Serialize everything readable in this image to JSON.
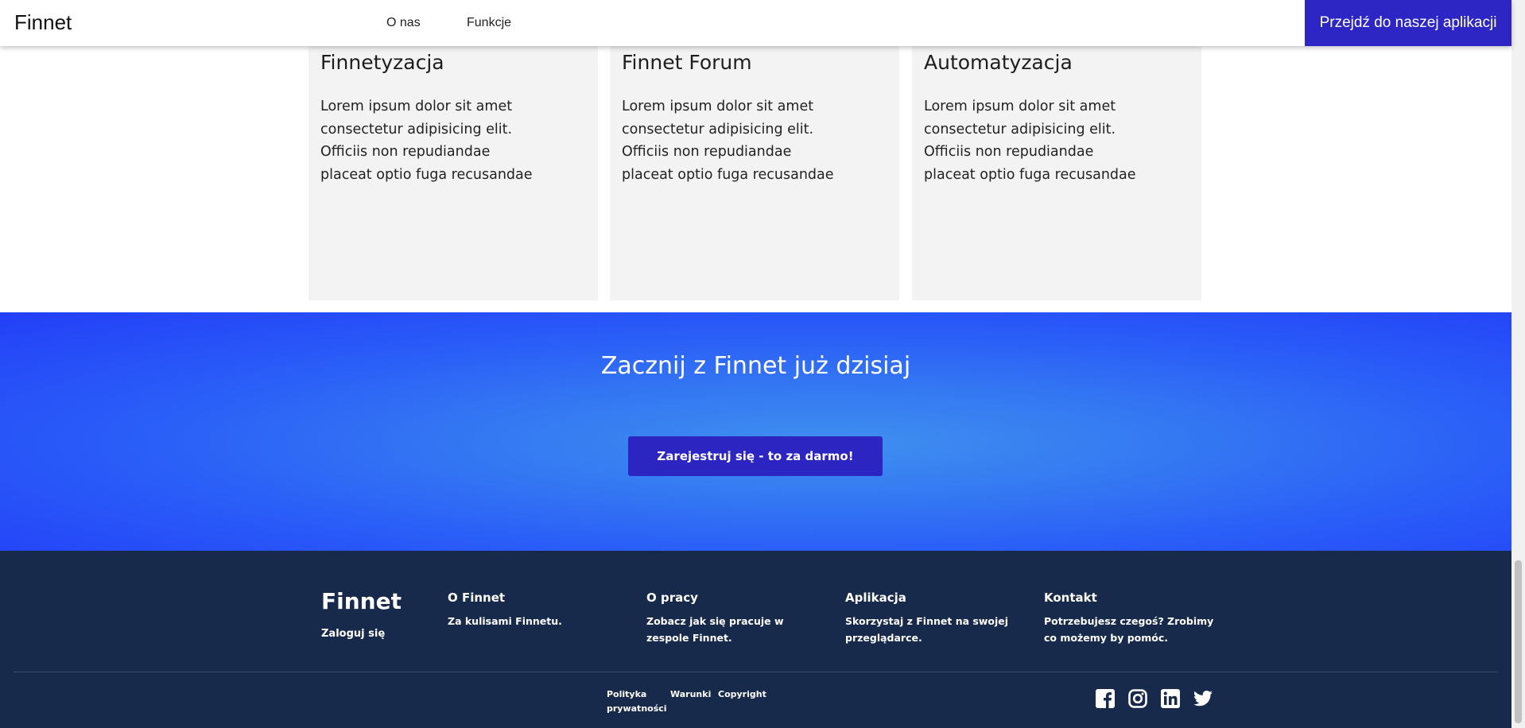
{
  "navbar": {
    "brand": "Finnet",
    "links": [
      {
        "label": "O nas"
      },
      {
        "label": "Funkcje"
      }
    ],
    "cta_label": "Przejdź do naszej aplikacji"
  },
  "cards": [
    {
      "title": "Finnetyzacja",
      "text": "Lorem ipsum dolor sit amet consectetur adipisicing elit. Officiis non repudiandae placeat optio fuga recusandae"
    },
    {
      "title": "Finnet Forum",
      "text": "Lorem ipsum dolor sit amet consectetur adipisicing elit. Officiis non repudiandae placeat optio fuga recusandae"
    },
    {
      "title": "Automatyzacja",
      "text": "Lorem ipsum dolor sit amet consectetur adipisicing elit. Officiis non repudiandae placeat optio fuga recusandae"
    }
  ],
  "cta": {
    "title": "Zacznij z Finnet już dzisiaj",
    "button_label": "Zarejestruj się - to za darmo!"
  },
  "footer": {
    "brand": "Finnet",
    "login_label": "Zaloguj się",
    "columns": [
      {
        "title": "O Finnet",
        "text": "Za kulisami Finnetu."
      },
      {
        "title": "O pracy",
        "text": "Zobacz jak się pracuje w zespole Finnet."
      },
      {
        "title": "Aplikacja",
        "text": "Skorzystaj z Finnet na swojej przeglądarce."
      },
      {
        "title": "Kontakt",
        "text": "Potrzebujesz czegoś? Zrobimy co możemy by pomóc."
      }
    ],
    "legal": [
      {
        "label": "Polityka prywatności"
      },
      {
        "label": "Warunki"
      },
      {
        "label": "Copyright"
      }
    ],
    "social_icons": [
      "facebook-icon",
      "instagram-icon",
      "linkedin-icon",
      "twitter-icon"
    ]
  },
  "colors": {
    "brand_blue": "#2e26c4",
    "cta_gradient_center": "#3f8ff0",
    "cta_gradient_edge": "#233ff7",
    "footer_bg": "#182a4c",
    "card_bg": "#f3f3f3"
  }
}
